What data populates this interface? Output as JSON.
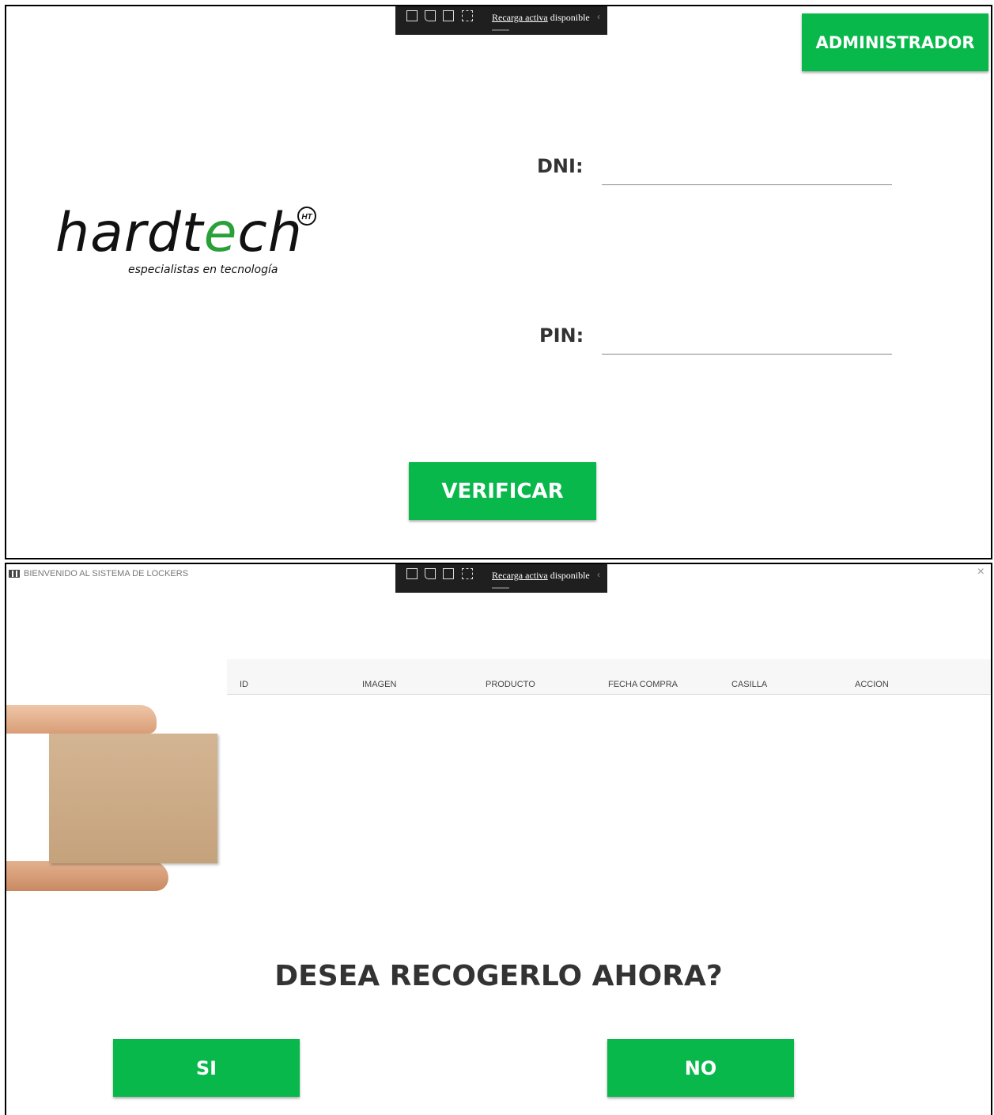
{
  "login": {
    "admin_label": "ADMINISTRADOR",
    "logo_word": "hardtech",
    "logo_badge": "HT",
    "logo_tagline": "especialistas en tecnología",
    "dni_label": "DNI:",
    "pin_label": "PIN:",
    "dni_value": "",
    "pin_value": "",
    "verify_label": "VERIFICAR"
  },
  "devbar": {
    "reload_link": "Recarga activa",
    "reload_status": " disponible"
  },
  "pickup": {
    "window_title": "BIENVENIDO AL SISTEMA DE LOCKERS",
    "columns": [
      "ID",
      "IMAGEN",
      "PRODUCTO",
      "FECHA COMPRA",
      "CASILLA",
      "ACCION"
    ],
    "question": "DESEA RECOGERLO AHORA?",
    "yes_label": "SI",
    "no_label": "NO"
  },
  "colors": {
    "accent": "#08b84a",
    "text": "#333333"
  },
  "icons": [
    "app-grid-icon",
    "close-icon",
    "select-element-icon",
    "pointer-icon",
    "frame-icon",
    "screenshot-icon",
    "chevron-left-icon"
  ]
}
